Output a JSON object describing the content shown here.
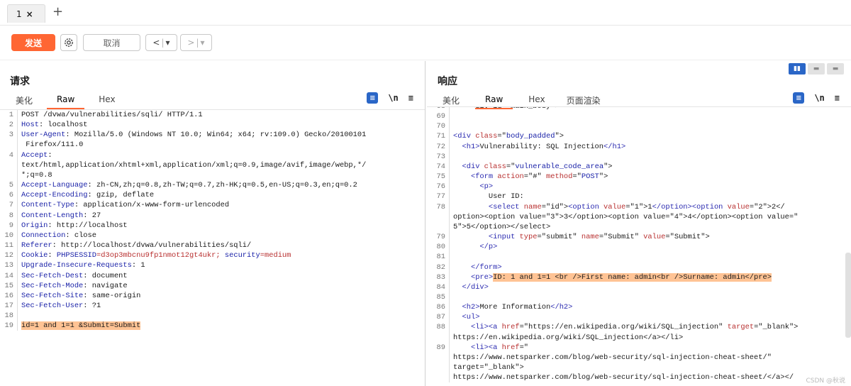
{
  "tabs": [
    {
      "label": "1",
      "close": "×"
    }
  ],
  "tab_add": "+",
  "toolbar": {
    "send_label": "发送",
    "cancel_label": "取消",
    "back_label": "<",
    "fwd_label": ">",
    "dropdown_glyph": "▾"
  },
  "request": {
    "title": "请求",
    "subtabs": [
      "美化",
      "Raw",
      "Hex"
    ],
    "active_subtab": "Raw",
    "tool_wrap": "\\n",
    "tool_menu": "≡",
    "lines": [
      {
        "n": "1",
        "parts": [
          {
            "t": "POST /dvwa/vulnerabilities/sqli/ HTTP/1.1"
          }
        ]
      },
      {
        "n": "2",
        "parts": [
          {
            "t": "Host",
            "c": "k"
          },
          {
            "t": ": localhost"
          }
        ]
      },
      {
        "n": "3",
        "parts": [
          {
            "t": "User-Agent",
            "c": "k"
          },
          {
            "t": ": Mozilla/5.0 (Windows NT 10.0; Win64; x64; rv:109.0) Gecko/20100101"
          }
        ],
        "cont": [
          " Firefox/111.0"
        ]
      },
      {
        "n": "4",
        "parts": [
          {
            "t": "Accept",
            "c": "k"
          },
          {
            "t": ":"
          }
        ],
        "cont": [
          "text/html,application/xhtml+xml,application/xml;q=0.9,image/avif,image/webp,*/",
          "*;q=0.8"
        ]
      },
      {
        "n": "5",
        "parts": [
          {
            "t": "Accept-Language",
            "c": "k"
          },
          {
            "t": ": zh-CN,zh;q=0.8,zh-TW;q=0.7,zh-HK;q=0.5,en-US;q=0.3,en;q=0.2"
          }
        ]
      },
      {
        "n": "6",
        "parts": [
          {
            "t": "Accept-Encoding",
            "c": "k"
          },
          {
            "t": ": gzip, deflate"
          }
        ]
      },
      {
        "n": "7",
        "parts": [
          {
            "t": "Content-Type",
            "c": "k"
          },
          {
            "t": ": application/x-www-form-urlencoded"
          }
        ]
      },
      {
        "n": "8",
        "parts": [
          {
            "t": "Content-Length",
            "c": "k"
          },
          {
            "t": ": 27"
          }
        ]
      },
      {
        "n": "9",
        "parts": [
          {
            "t": "Origin",
            "c": "k"
          },
          {
            "t": ": http://localhost"
          }
        ]
      },
      {
        "n": "10",
        "parts": [
          {
            "t": "Connection",
            "c": "k"
          },
          {
            "t": ": close"
          }
        ]
      },
      {
        "n": "11",
        "parts": [
          {
            "t": "Referer",
            "c": "k"
          },
          {
            "t": ": http://localhost/dvwa/vulnerabilities/sqli/"
          }
        ]
      },
      {
        "n": "12",
        "parts": [
          {
            "t": "Cookie",
            "c": "k"
          },
          {
            "t": ": "
          },
          {
            "t": "PHPSESSID",
            "c": "k"
          },
          {
            "t": "=d3op3mbcnu9fp1nmot12gt4ukr; ",
            "c": "at"
          },
          {
            "t": "security",
            "c": "k"
          },
          {
            "t": "=medium",
            "c": "at"
          }
        ]
      },
      {
        "n": "13",
        "parts": [
          {
            "t": "Upgrade-Insecure-Requests",
            "c": "k"
          },
          {
            "t": ": 1"
          }
        ]
      },
      {
        "n": "14",
        "parts": [
          {
            "t": "Sec-Fetch-Dest",
            "c": "k"
          },
          {
            "t": ": document"
          }
        ]
      },
      {
        "n": "15",
        "parts": [
          {
            "t": "Sec-Fetch-Mode",
            "c": "k"
          },
          {
            "t": ": navigate"
          }
        ]
      },
      {
        "n": "16",
        "parts": [
          {
            "t": "Sec-Fetch-Site",
            "c": "k"
          },
          {
            "t": ": same-origin"
          }
        ]
      },
      {
        "n": "17",
        "parts": [
          {
            "t": "Sec-Fetch-User",
            "c": "k"
          },
          {
            "t": ": ?1"
          }
        ]
      },
      {
        "n": "18",
        "parts": [
          {
            "t": ""
          }
        ]
      },
      {
        "n": "19",
        "parts": [
          {
            "t": "id=1 and 1=1 &Submit=Submit",
            "c": "hl"
          }
        ]
      }
    ]
  },
  "response": {
    "title": "响应",
    "subtabs": [
      "美化",
      "Raw",
      "Hex",
      "页面渲染"
    ],
    "active_subtab": "Raw",
    "tool_wrap": "\\n",
    "tool_menu": "≡",
    "lines": [
      {
        "n": "68",
        "parts": [
          {
            "t": "    <div id=\"main_body\">"
          }
        ]
      },
      {
        "n": "69",
        "parts": [
          {
            "t": ""
          }
        ]
      },
      {
        "n": "70",
        "parts": [
          {
            "t": ""
          }
        ]
      },
      {
        "n": "71",
        "parts": [
          {
            "t": "<div ",
            "c": "tg"
          },
          {
            "t": "class",
            "c": "at"
          },
          {
            "t": "=\""
          },
          {
            "t": "body_padded",
            "c": "av"
          },
          {
            "t": "\">"
          }
        ]
      },
      {
        "n": "72",
        "parts": [
          {
            "t": "  <h1>",
            "c": "tg"
          },
          {
            "t": "Vulnerability: SQL Injection"
          },
          {
            "t": "</h1>",
            "c": "tg"
          }
        ]
      },
      {
        "n": "73",
        "parts": [
          {
            "t": ""
          }
        ]
      },
      {
        "n": "74",
        "parts": [
          {
            "t": "  <div ",
            "c": "tg"
          },
          {
            "t": "class",
            "c": "at"
          },
          {
            "t": "=\""
          },
          {
            "t": "vulnerable_code_area",
            "c": "av"
          },
          {
            "t": "\">"
          }
        ]
      },
      {
        "n": "75",
        "parts": [
          {
            "t": "    <form ",
            "c": "tg"
          },
          {
            "t": "action",
            "c": "at"
          },
          {
            "t": "=\"#\" "
          },
          {
            "t": "method",
            "c": "at"
          },
          {
            "t": "=\""
          },
          {
            "t": "POST",
            "c": "av"
          },
          {
            "t": "\">"
          }
        ]
      },
      {
        "n": "76",
        "parts": [
          {
            "t": "      <p>",
            "c": "tg"
          }
        ]
      },
      {
        "n": "77",
        "parts": [
          {
            "t": "        User ID:"
          }
        ]
      },
      {
        "n": "78",
        "parts": [
          {
            "t": "        <select ",
            "c": "tg"
          },
          {
            "t": "name",
            "c": "at"
          },
          {
            "t": "=\"id\">"
          },
          {
            "t": "<option ",
            "c": "tg"
          },
          {
            "t": "value",
            "c": "at"
          },
          {
            "t": "=\"1\">1"
          },
          {
            "t": "</option><option ",
            "c": "tg"
          },
          {
            "t": "value",
            "c": "at"
          },
          {
            "t": "=\"2\">2</"
          }
        ],
        "cont": [
          "option><option value=\"3\">3</option><option value=\"4\">4</option><option value=\"",
          "5\">5</option></select>"
        ]
      },
      {
        "n": "79",
        "parts": [
          {
            "t": "        <input ",
            "c": "tg"
          },
          {
            "t": "type",
            "c": "at"
          },
          {
            "t": "=\"submit\" "
          },
          {
            "t": "name",
            "c": "at"
          },
          {
            "t": "=\"Submit\" "
          },
          {
            "t": "value",
            "c": "at"
          },
          {
            "t": "=\"Submit\">"
          }
        ]
      },
      {
        "n": "80",
        "parts": [
          {
            "t": "      </p>",
            "c": "tg"
          }
        ]
      },
      {
        "n": "81",
        "parts": [
          {
            "t": ""
          }
        ]
      },
      {
        "n": "82",
        "parts": [
          {
            "t": "    </form>",
            "c": "tg"
          }
        ]
      },
      {
        "n": "83",
        "parts": [
          {
            "t": "    <pre>",
            "c": "tg"
          },
          {
            "t": "ID: 1 and 1=1 <br />First name: admin<br />Surname: admin</pre>",
            "c": "hl"
          }
        ]
      },
      {
        "n": "84",
        "parts": [
          {
            "t": "  </div>",
            "c": "tg"
          }
        ]
      },
      {
        "n": "85",
        "parts": [
          {
            "t": ""
          }
        ]
      },
      {
        "n": "86",
        "parts": [
          {
            "t": "  <h2>",
            "c": "tg"
          },
          {
            "t": "More Information"
          },
          {
            "t": "</h2>",
            "c": "tg"
          }
        ]
      },
      {
        "n": "87",
        "parts": [
          {
            "t": "  <ul>",
            "c": "tg"
          }
        ]
      },
      {
        "n": "88",
        "parts": [
          {
            "t": "    <li><a ",
            "c": "tg"
          },
          {
            "t": "href",
            "c": "at"
          },
          {
            "t": "=\"https://en.wikipedia.org/wiki/SQL_injection\" "
          },
          {
            "t": "target",
            "c": "at"
          },
          {
            "t": "=\"_blank\">"
          }
        ],
        "cont": [
          "https://en.wikipedia.org/wiki/SQL_injection</a></li>"
        ]
      },
      {
        "n": "89",
        "parts": [
          {
            "t": "    <li><a ",
            "c": "tg"
          },
          {
            "t": "href",
            "c": "at"
          },
          {
            "t": "=\""
          }
        ],
        "cont": [
          "https://www.netsparker.com/blog/web-security/sql-injection-cheat-sheet/\"",
          "target=\"_blank\">",
          "https://www.netsparker.com/blog/web-security/sql-injection-cheat-sheet/</a></"
        ]
      }
    ]
  },
  "watermark": "CSDN @秋说"
}
